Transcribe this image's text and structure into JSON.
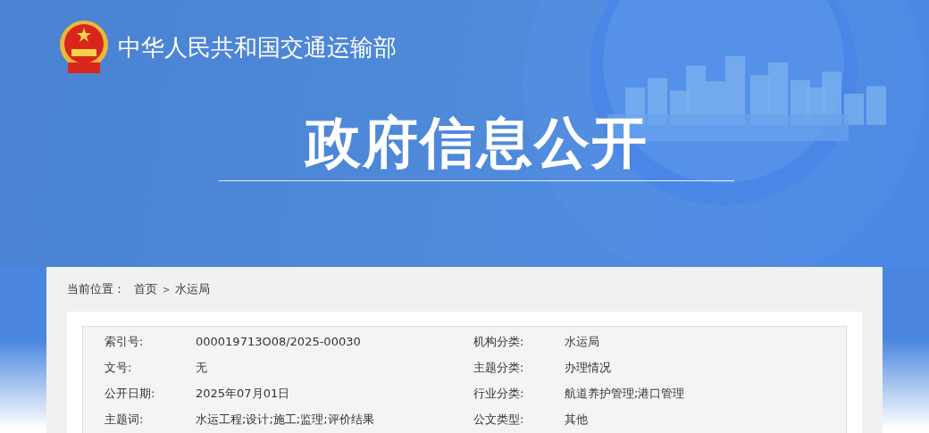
{
  "header": {
    "site_name": "中华人民共和国交通运输部",
    "banner_title": "政府信息公开"
  },
  "breadcrumb": {
    "label": "当前位置：",
    "items": [
      "首页",
      "水运局"
    ],
    "separator": ">"
  },
  "metadata": [
    {
      "label": "索引号:",
      "value": "000019713O08/2025-00030"
    },
    {
      "label": "机构分类:",
      "value": "水运局"
    },
    {
      "label": "文号:",
      "value": "无"
    },
    {
      "label": "主题分类:",
      "value": "办理情况"
    },
    {
      "label": "公开日期:",
      "value": "2025年07月01日"
    },
    {
      "label": "行业分类:",
      "value": "航道养护管理;港口管理"
    },
    {
      "label": "主题词:",
      "value": "水运工程;设计;施工;监理;评价结果"
    },
    {
      "label": "公文类型:",
      "value": "其他"
    }
  ]
}
